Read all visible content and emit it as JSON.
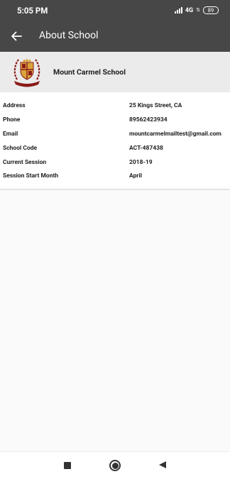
{
  "status_bar": {
    "time": "5:05 PM",
    "network": "4G",
    "battery": "89"
  },
  "app_bar": {
    "title": "About School",
    "back_icon": "arrow-left-icon"
  },
  "school": {
    "name": "Mount Carmel School",
    "logo_icon": "school-crest-icon",
    "logo_colors": {
      "maroon": "#8b1a1a",
      "gold": "#d9a43a"
    }
  },
  "details": [
    {
      "label": "Address",
      "value": "25 Kings Street, CA"
    },
    {
      "label": "Phone",
      "value": "89562423934"
    },
    {
      "label": "Email",
      "value": "mountcarmelmailtest@gmail.com"
    },
    {
      "label": "School Code",
      "value": "ACT-487438"
    },
    {
      "label": "Current Session",
      "value": "2018-19"
    },
    {
      "label": "Session Start Month",
      "value": "April"
    }
  ],
  "nav_bar": {
    "recents_icon": "square-icon",
    "home_icon": "circle-icon",
    "back_icon": "triangle-back-icon"
  },
  "colors": {
    "app_bar": "#474747",
    "school_card": "#ebebeb",
    "background": "#fafafa"
  }
}
